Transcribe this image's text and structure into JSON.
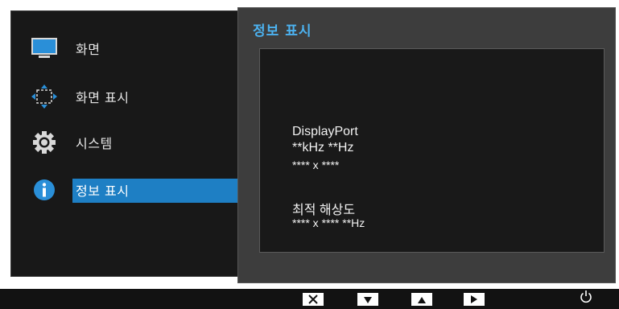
{
  "menu": {
    "items": [
      {
        "label": "화면",
        "icon": "monitor-icon"
      },
      {
        "label": "화면 표시",
        "icon": "position-arrows-icon"
      },
      {
        "label": "시스템",
        "icon": "gear-icon"
      },
      {
        "label": "정보 표시",
        "icon": "info-icon",
        "selected": true
      }
    ]
  },
  "info": {
    "title": "정보 표시",
    "source": "DisplayPort",
    "frequency": "**kHz **Hz",
    "resolution": "**** x ****",
    "optimal_label": "최적 해상도",
    "optimal_value": "**** x **** **Hz"
  },
  "buttons": [
    "close-icon",
    "down-arrow-icon",
    "up-arrow-icon",
    "right-arrow-icon",
    "power-icon"
  ],
  "colors": {
    "accent": "#1e7fc4",
    "title": "#4cb2f0",
    "panel": "#3d3d3d",
    "menu_bg": "#181818",
    "icon_blue": "#2a8fd8"
  }
}
